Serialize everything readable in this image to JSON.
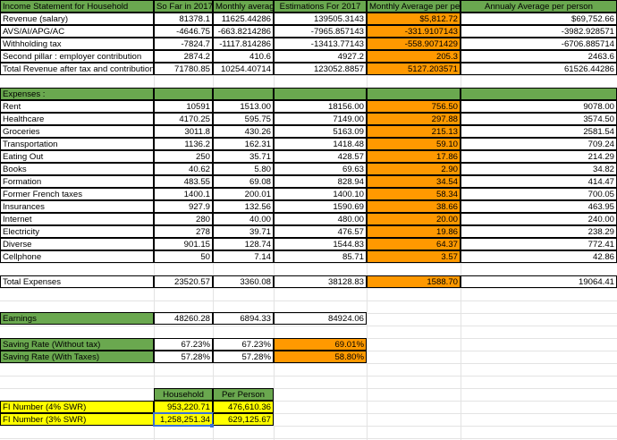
{
  "colors": {
    "green": "#6aa84f",
    "orange": "#ff9900",
    "yellow": "#ffff00"
  },
  "header": {
    "col_a": "Income Statement for Household",
    "col_b": "So Far in 2017",
    "col_c": "Monthly average",
    "col_d": "Estimations For 2017",
    "col_e": "Monthly Average per person",
    "col_f": "Annualy Average per person"
  },
  "income": [
    {
      "label": "Revenue (salary)",
      "b": "81378.1",
      "c": "11625.44286",
      "d": "139505.3143",
      "e": "$5,812.72",
      "f": "$69,752.66"
    },
    {
      "label": "AVS/AI/APG/AC",
      "b": "-4646.75",
      "c": "-663.8214286",
      "d": "-7965.857143",
      "e": "-331.9107143",
      "f": "-3982.928571"
    },
    {
      "label": "Withholding tax",
      "b": "-7824.7",
      "c": "-1117.814286",
      "d": "-13413.77143",
      "e": "-558.9071429",
      "f": "-6706.885714"
    },
    {
      "label": "Second pillar : employer contribution",
      "b": "2874.2",
      "c": "410.6",
      "d": "4927.2",
      "e": "205.3",
      "f": "2463.6"
    },
    {
      "label": "Total Revenue after tax and contributions",
      "b": "71780.85",
      "c": "10254.40714",
      "d": "123052.8857",
      "e": "5127.203571",
      "f": "61526.44286"
    }
  ],
  "expenses_header": "Expenses :",
  "expenses": [
    {
      "label": "Rent",
      "b": "10591",
      "c": "1513.00",
      "d": "18156.00",
      "e": "756.50",
      "f": "9078.00"
    },
    {
      "label": "Healthcare",
      "b": "4170.25",
      "c": "595.75",
      "d": "7149.00",
      "e": "297.88",
      "f": "3574.50"
    },
    {
      "label": "Groceries",
      "b": "3011.8",
      "c": "430.26",
      "d": "5163.09",
      "e": "215.13",
      "f": "2581.54"
    },
    {
      "label": "Transportation",
      "b": "1136.2",
      "c": "162.31",
      "d": "1418.48",
      "e": "59.10",
      "f": "709.24"
    },
    {
      "label": "Eating Out",
      "b": "250",
      "c": "35.71",
      "d": "428.57",
      "e": "17.86",
      "f": "214.29"
    },
    {
      "label": "Books",
      "b": "40.62",
      "c": "5.80",
      "d": "69.63",
      "e": "2.90",
      "f": "34.82"
    },
    {
      "label": "Formation",
      "b": "483.55",
      "c": "69.08",
      "d": "828.94",
      "e": "34.54",
      "f": "414.47"
    },
    {
      "label": "Former French taxes",
      "b": "1400.1",
      "c": "200.01",
      "d": "1400.10",
      "e": "58.34",
      "f": "700.05"
    },
    {
      "label": "Insurances",
      "b": "927.9",
      "c": "132.56",
      "d": "1590.69",
      "e": "38.66",
      "f": "463.95"
    },
    {
      "label": "Internet",
      "b": "280",
      "c": "40.00",
      "d": "480.00",
      "e": "20.00",
      "f": "240.00"
    },
    {
      "label": "Electricity",
      "b": "278",
      "c": "39.71",
      "d": "476.57",
      "e": "19.86",
      "f": "238.29"
    },
    {
      "label": "Diverse",
      "b": "901.15",
      "c": "128.74",
      "d": "1544.83",
      "e": "64.37",
      "f": "772.41"
    },
    {
      "label": "Cellphone",
      "b": "50",
      "c": "7.14",
      "d": "85.71",
      "e": "3.57",
      "f": "42.86"
    }
  ],
  "total_expenses": {
    "label": "Total Expenses",
    "b": "23520.57",
    "c": "3360.08",
    "d": "38128.83",
    "e": "1588.70",
    "f": "19064.41"
  },
  "earnings": {
    "label": "Earnings",
    "b": "48260.28",
    "c": "6894.33",
    "d": "84924.06"
  },
  "saving": [
    {
      "label": "Saving Rate (Without tax)",
      "b": "67.23%",
      "c": "67.23%",
      "d": "69.01%"
    },
    {
      "label": "Saving Rate (With Taxes)",
      "b": "57.28%",
      "c": "57.28%",
      "d": "58.80%"
    }
  ],
  "fi_header": {
    "b": "Household",
    "c": "Per Person"
  },
  "fi": [
    {
      "label": "FI Number (4% SWR)",
      "b": "953,220.71",
      "c": "476,610.36"
    },
    {
      "label": "FI Number (3% SWR)",
      "b": "1,258,251.34",
      "c": "629,125.67"
    }
  ]
}
